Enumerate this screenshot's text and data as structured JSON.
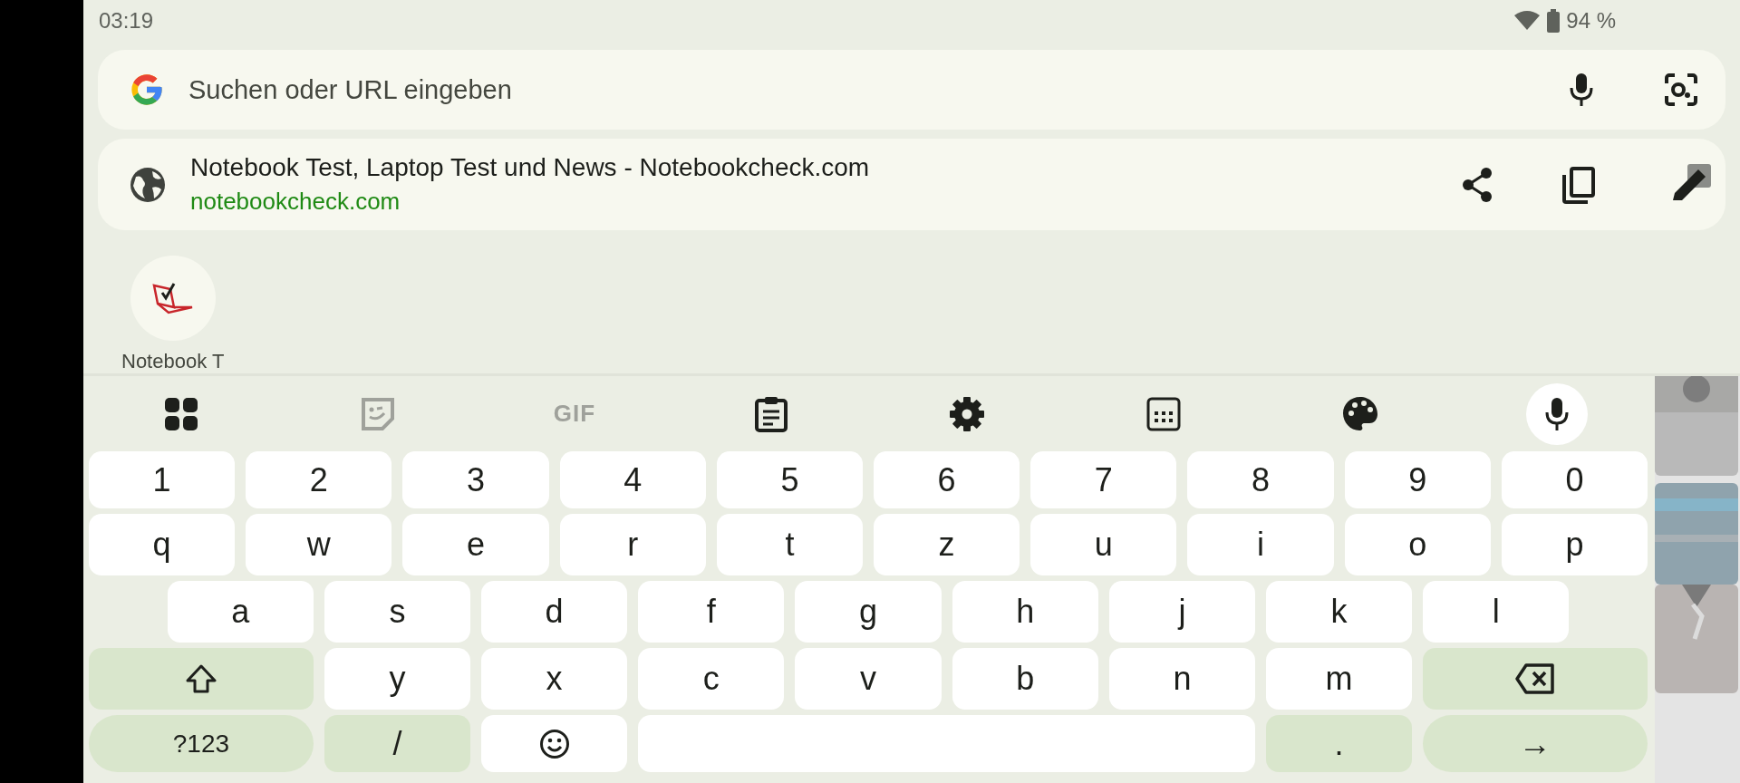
{
  "status_bar": {
    "time": "03:19",
    "battery": "94 %"
  },
  "search": {
    "placeholder": "Suchen oder URL eingeben"
  },
  "suggestion": {
    "title": "Notebook Test, Laptop Test und News - Notebookcheck.com",
    "url": "notebookcheck.com"
  },
  "shortcuts": [
    {
      "label": "Notebook T"
    }
  ],
  "keyboard": {
    "toolbar": [
      {
        "kind": "apps",
        "disabled": false
      },
      {
        "kind": "sticker",
        "disabled": true
      },
      {
        "kind": "gif",
        "label": "GIF",
        "disabled": true
      },
      {
        "kind": "clipboard",
        "disabled": false
      },
      {
        "kind": "settings",
        "disabled": false
      },
      {
        "kind": "layout",
        "disabled": false
      },
      {
        "kind": "theme",
        "disabled": false
      },
      {
        "kind": "voice",
        "disabled": false
      }
    ],
    "rows": [
      [
        {
          "kind": "char",
          "label": "1"
        },
        {
          "kind": "char",
          "label": "2"
        },
        {
          "kind": "char",
          "label": "3"
        },
        {
          "kind": "char",
          "label": "4"
        },
        {
          "kind": "char",
          "label": "5"
        },
        {
          "kind": "char",
          "label": "6"
        },
        {
          "kind": "char",
          "label": "7"
        },
        {
          "kind": "char",
          "label": "8"
        },
        {
          "kind": "char",
          "label": "9"
        },
        {
          "kind": "char",
          "label": "0"
        }
      ],
      [
        {
          "kind": "char",
          "label": "q"
        },
        {
          "kind": "char",
          "label": "w"
        },
        {
          "kind": "char",
          "label": "e"
        },
        {
          "kind": "char",
          "label": "r"
        },
        {
          "kind": "char",
          "label": "t"
        },
        {
          "kind": "char",
          "label": "z"
        },
        {
          "kind": "char",
          "label": "u"
        },
        {
          "kind": "char",
          "label": "i"
        },
        {
          "kind": "char",
          "label": "o"
        },
        {
          "kind": "char",
          "label": "p"
        }
      ],
      [
        {
          "kind": "gap"
        },
        {
          "kind": "char",
          "label": "a"
        },
        {
          "kind": "char",
          "label": "s"
        },
        {
          "kind": "char",
          "label": "d"
        },
        {
          "kind": "char",
          "label": "f"
        },
        {
          "kind": "char",
          "label": "g"
        },
        {
          "kind": "char",
          "label": "h"
        },
        {
          "kind": "char",
          "label": "j"
        },
        {
          "kind": "char",
          "label": "k"
        },
        {
          "kind": "char",
          "label": "l"
        }
      ],
      [
        {
          "kind": "shift"
        },
        {
          "kind": "char",
          "label": "y"
        },
        {
          "kind": "char",
          "label": "x"
        },
        {
          "kind": "char",
          "label": "c"
        },
        {
          "kind": "char",
          "label": "v"
        },
        {
          "kind": "char",
          "label": "b"
        },
        {
          "kind": "char",
          "label": "n"
        },
        {
          "kind": "char",
          "label": "m"
        },
        {
          "kind": "backspace"
        }
      ],
      [
        {
          "kind": "symbols",
          "label": "?123"
        },
        {
          "kind": "func",
          "label": "/"
        },
        {
          "kind": "emoji"
        },
        {
          "kind": "space"
        },
        {
          "kind": "func",
          "label": "."
        },
        {
          "kind": "enter",
          "label": "→"
        }
      ]
    ]
  }
}
